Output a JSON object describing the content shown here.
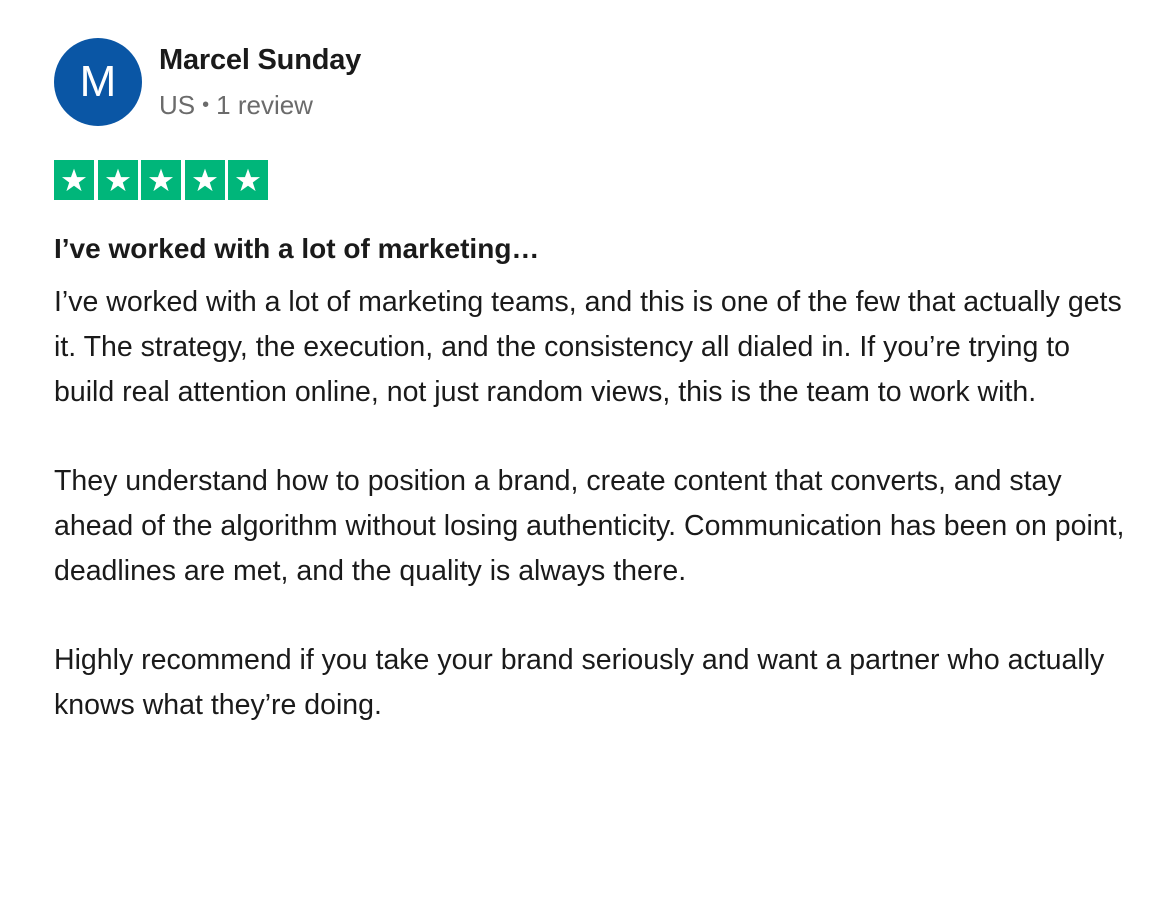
{
  "reviewer": {
    "avatar_letter": "M",
    "avatar_color": "#0a56a5",
    "name": "Marcel Sunday",
    "country": "US",
    "separator": "•",
    "review_count": "1 review"
  },
  "rating": {
    "stars": 5,
    "max_stars": 5,
    "star_color": "#00b67a",
    "icon": "star-icon"
  },
  "review": {
    "title": "I’ve worked with a lot of marketing…",
    "paragraphs": [
      "I’ve worked with a lot of marketing teams, and this is one of the few that actually gets it. The strategy, the execution, and the consistency all dialed in. If you’re trying to build real attention online, not just random views, this is the team to work with.",
      "They understand how to position a brand, create content that converts, and stay ahead of the algorithm without losing authenticity. Communication has been on point, deadlines are met, and the quality is always there.",
      "Highly recommend if you take your brand seriously and want a partner who actually knows what they’re doing."
    ]
  }
}
